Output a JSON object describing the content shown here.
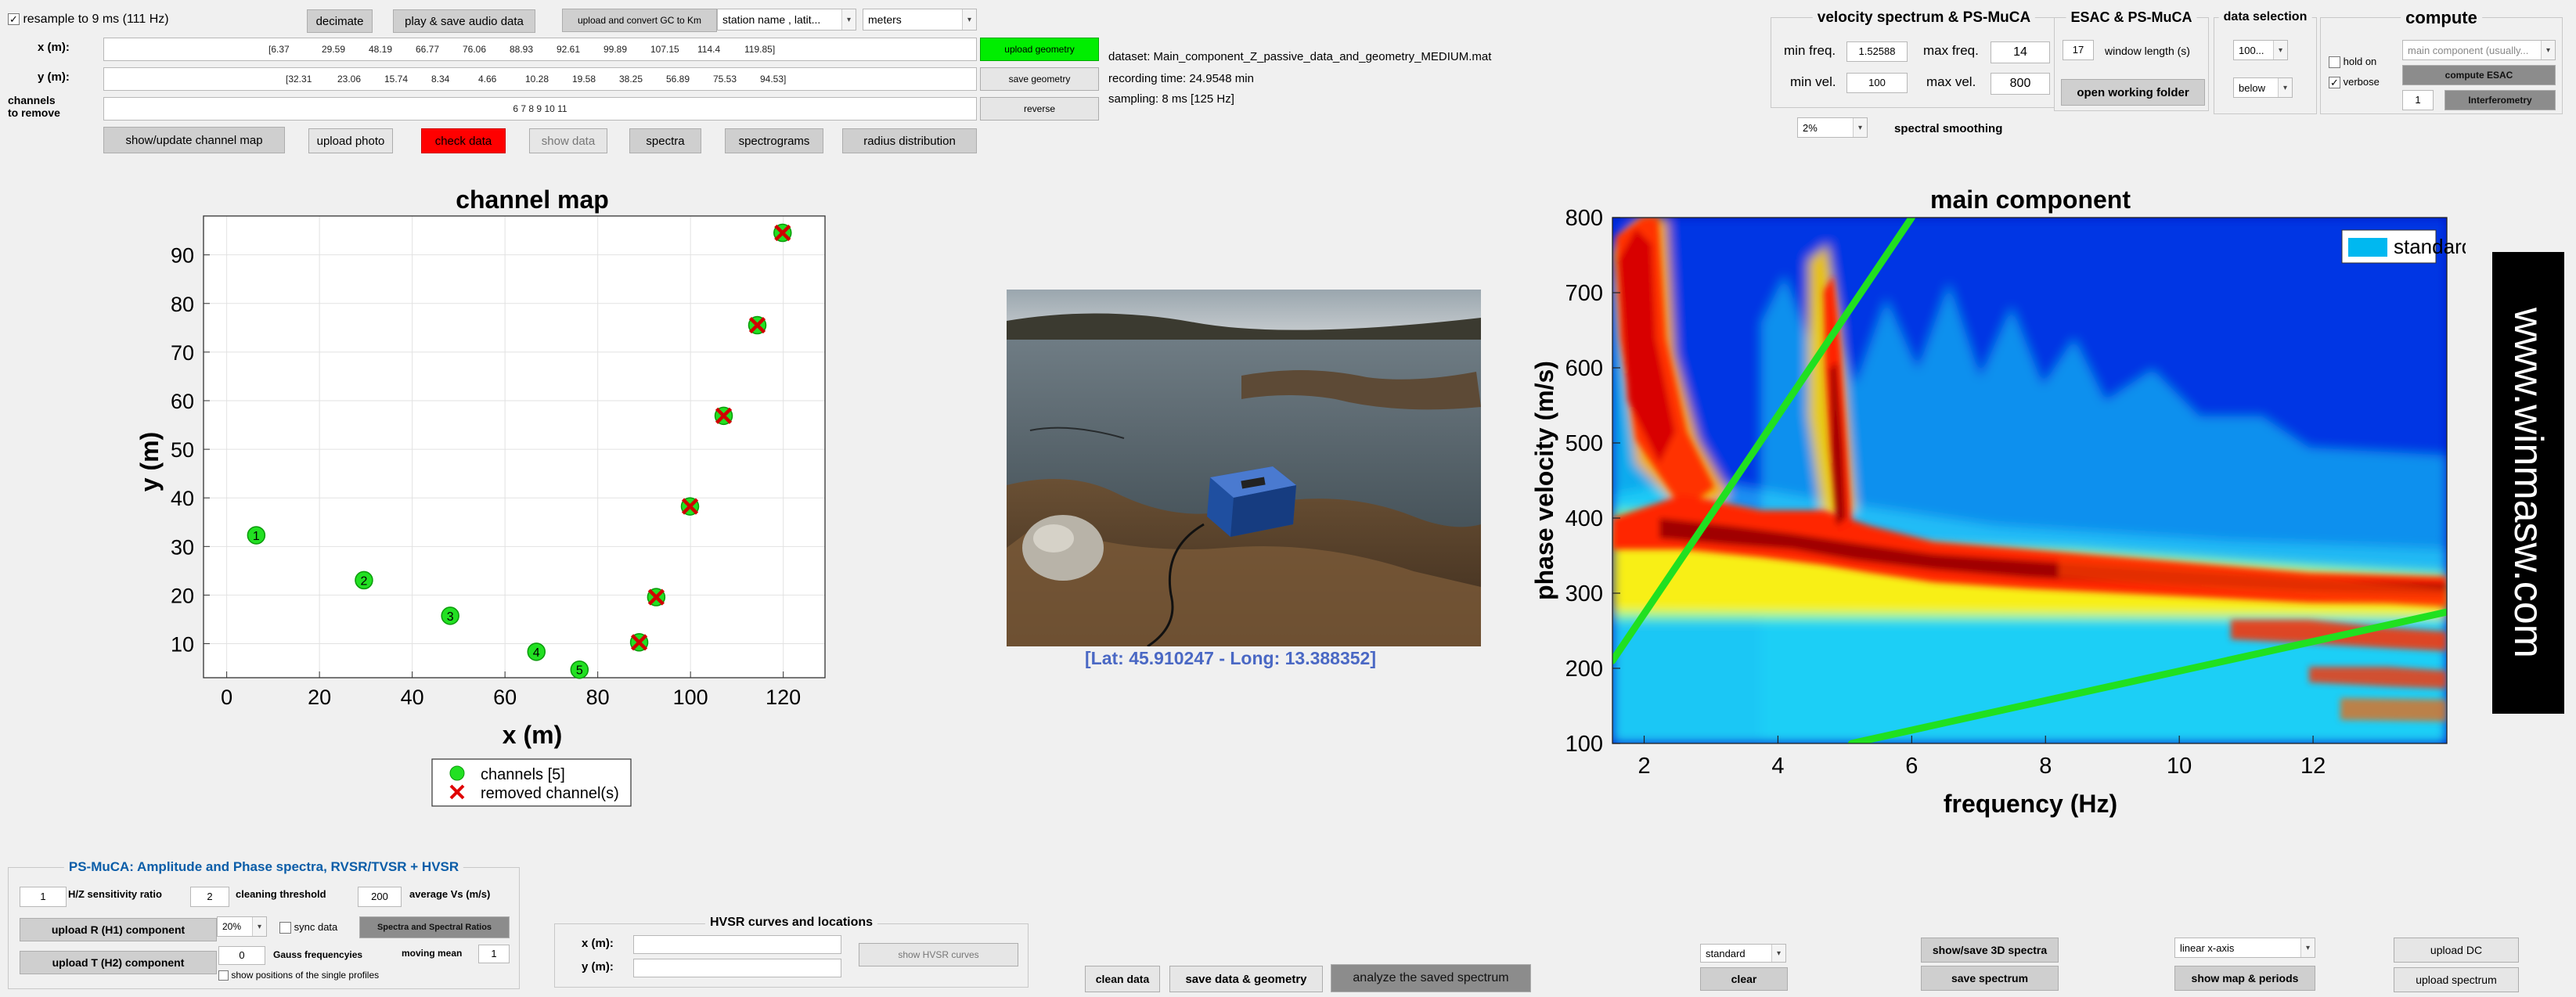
{
  "top": {
    "resample": {
      "label": "resample to 9 ms (111 Hz)",
      "checked": true
    },
    "decimate": "decimate",
    "play_save": "play & save audio data",
    "upload_convert": "upload and convert GC to Km",
    "station_select": "station name , latit...",
    "units_select": "meters",
    "upload_geometry": "upload geometry",
    "save_geometry": "save geometry",
    "reverse": "reverse",
    "x_label": "x (m):",
    "y_label": "y (m):",
    "x_first": "[6.37",
    "x_values": [
      "29.59",
      "48.19",
      "66.77",
      "76.06",
      "88.93",
      "92.61",
      "99.89",
      "107.15",
      "114.4"
    ],
    "x_last": "119.85]",
    "y_first": "[32.31",
    "y_values": [
      "23.06",
      "15.74",
      "8.34",
      "4.66",
      "10.28",
      "19.58",
      "38.25",
      "56.89",
      "75.53"
    ],
    "y_last": "94.53]",
    "channels_label": "channels\nto remove",
    "channels_value": "6 7 8 9 10 11",
    "dataset": "dataset: Main_component_Z_passive_data_and_geometry_MEDIUM.mat",
    "recording": "recording time: 24.9548 min",
    "sampling": "sampling: 8 ms [125 Hz]",
    "buttons": {
      "show_map": "show/update channel map",
      "upload_photo": "upload photo",
      "check_data": "check data",
      "show_data": "show data",
      "spectra": "spectra",
      "spectrograms": "spectrograms",
      "radius": "radius distribution"
    }
  },
  "velocity_panel": {
    "title": "velocity spectrum & PS-MuCA",
    "min_freq_label": "min freq.",
    "min_freq": "1.52588",
    "max_freq_label": "max freq.",
    "max_freq": "14",
    "min_vel_label": "min vel.",
    "min_vel": "100",
    "max_vel_label": "max vel.",
    "max_vel": "800",
    "smoothing_select": "2%",
    "smoothing_label": "spectral smoothing"
  },
  "esac_panel": {
    "title": "ESAC & PS-MuCA",
    "window_value": "17",
    "window_label": "window length (s)",
    "open_folder": "open working folder"
  },
  "data_selection": {
    "title": "data selection",
    "select1": "100...",
    "select2": "below"
  },
  "compute_panel": {
    "title": "compute",
    "hold_on": "hold on",
    "verbose": "verbose",
    "verbose_checked": true,
    "hold_checked": false,
    "component_select": "main component (usually...",
    "compute_esac": "compute ESAC",
    "interf_value": "1",
    "interferometry": "Interferometry"
  },
  "psmuca_panel": {
    "title": "PS-MuCA: Amplitude and Phase spectra, RVSR/TVSR + HVSR",
    "hz_value": "1",
    "hz_label": "H/Z sensitivity ratio",
    "clean_value": "2",
    "clean_label": "cleaning threshold",
    "vs_value": "200",
    "vs_label": "average Vs (m/s)",
    "upload_r": "upload R (H1) component",
    "upload_t": "upload T (H2) component",
    "pct_select": "20%",
    "sync_data": "sync data",
    "spectral_ratios": "Spectra and Spectral Ratios",
    "gauss_value": "0",
    "gauss_label": "Gauss frequencyies",
    "moving_label": "moving mean",
    "moving_value": "1",
    "show_positions": "show positions of the single profiles"
  },
  "hvsr_panel": {
    "title": "HVSR curves and locations",
    "x_label": "x (m):",
    "y_label": "y (m):",
    "show_hvsr": "show HVSR curves"
  },
  "bottom": {
    "clean_data": "clean data",
    "save_data": "save data & geometry",
    "analyze": "analyze the saved spectrum",
    "standard_select": "standard",
    "clear": "clear",
    "show_save_3d": "show/save 3D spectra",
    "save_spectrum": "save spectrum",
    "axis_select": "linear x-axis",
    "show_map_periods": "show map & periods",
    "upload_dc": "upload DC",
    "upload_spectrum": "upload spectrum"
  },
  "photo_caption": "[Lat: 45.910247 - Long: 13.388352]",
  "logo_text": "www.winmasw.com",
  "colors": {
    "accent_green": "#00ee00",
    "check_red": "#ff0000",
    "blue_label": "#0b5da8",
    "caption_blue": "#4a68c4"
  },
  "chart_data": [
    {
      "type": "scatter",
      "title": "channel map",
      "xlabel": "x (m)",
      "ylabel": "y (m)",
      "xlim": [
        -5,
        129
      ],
      "ylim": [
        3,
        98
      ],
      "xticks": [
        0,
        20,
        40,
        60,
        80,
        100,
        120
      ],
      "yticks": [
        10,
        20,
        30,
        40,
        50,
        60,
        70,
        80,
        90
      ],
      "grid": true,
      "legend": "bottom-center",
      "series": [
        {
          "name": "channels [5]",
          "marker": "green-circle",
          "points": [
            {
              "x": 6.37,
              "y": 32.31,
              "label": "1"
            },
            {
              "x": 29.59,
              "y": 23.06,
              "label": "2"
            },
            {
              "x": 48.19,
              "y": 15.74,
              "label": "3"
            },
            {
              "x": 66.77,
              "y": 8.34,
              "label": "4"
            },
            {
              "x": 76.06,
              "y": 4.66,
              "label": "5"
            }
          ]
        },
        {
          "name": "removed channel(s)",
          "marker": "red-x",
          "points": [
            {
              "x": 88.93,
              "y": 10.28
            },
            {
              "x": 92.61,
              "y": 19.58
            },
            {
              "x": 99.89,
              "y": 38.25
            },
            {
              "x": 107.15,
              "y": 56.89
            },
            {
              "x": 114.4,
              "y": 75.53
            },
            {
              "x": 119.85,
              "y": 94.53
            }
          ]
        }
      ]
    },
    {
      "type": "heatmap",
      "title": "main component",
      "xlabel": "frequency (Hz)",
      "ylabel": "phase velocity (m/s)",
      "xlim": [
        1.52588,
        14
      ],
      "ylim": [
        100,
        800
      ],
      "xticks": [
        2,
        4,
        6,
        8,
        10,
        12
      ],
      "yticks": [
        100,
        200,
        300,
        400,
        500,
        600,
        700,
        800
      ],
      "legend": "top-right",
      "legend_label": "standard processing",
      "lines": [
        {
          "color": "#20e020",
          "points": [
            [
              1.52588,
              210
            ],
            [
              6.0,
              800
            ]
          ]
        },
        {
          "color": "#20e020",
          "points": [
            [
              5.1,
              100
            ],
            [
              14,
              275
            ]
          ]
        }
      ]
    }
  ]
}
